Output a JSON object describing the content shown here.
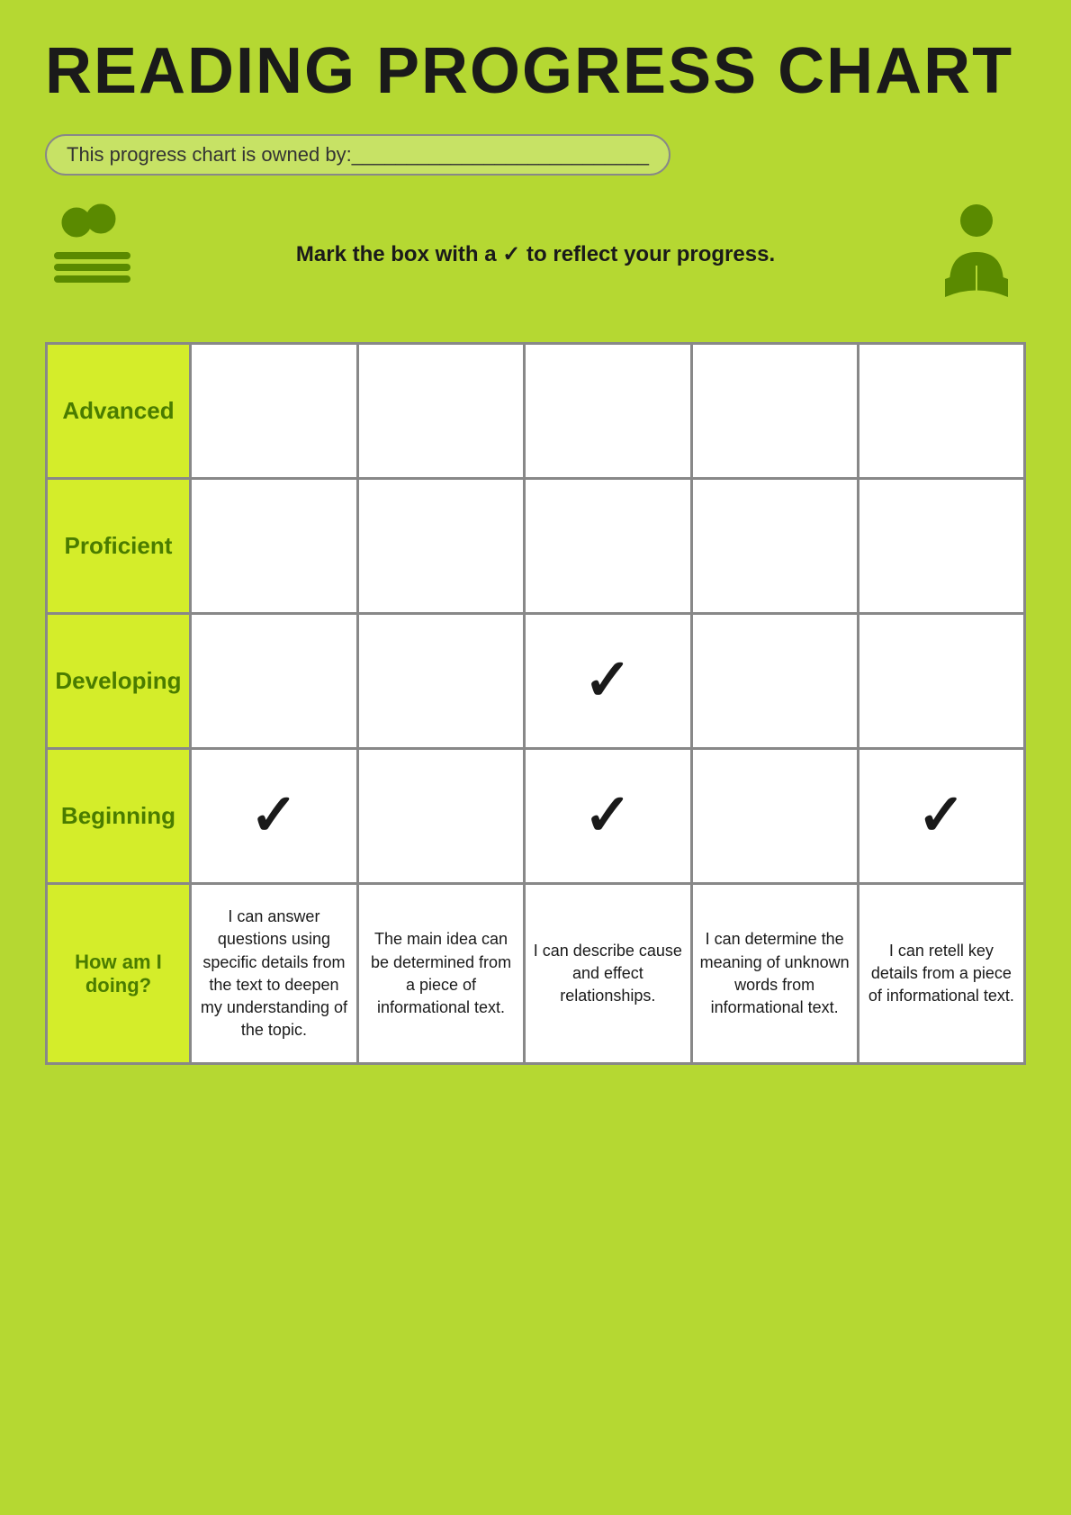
{
  "title": "READING PROGRESS CHART",
  "owner_label": "This progress chart is owned by:___________________________",
  "instructions": "Mark the box with a ✓ to reflect your progress.",
  "rows": [
    {
      "label": "Advanced",
      "checks": [
        false,
        false,
        false,
        false,
        false
      ]
    },
    {
      "label": "Proficient",
      "checks": [
        false,
        false,
        false,
        false,
        false
      ]
    },
    {
      "label": "Developing",
      "checks": [
        false,
        false,
        true,
        false,
        false
      ]
    },
    {
      "label": "Beginning",
      "checks": [
        true,
        false,
        true,
        false,
        true
      ]
    }
  ],
  "how_doing": {
    "label1": "How am I",
    "label2": "doing?",
    "descriptions": [
      "I can answer questions using specific details from the text to deepen my understanding of the topic.",
      "The main idea can be determined from a piece of informational text.",
      "I can describe cause and effect relationships.",
      "I can determine the meaning of unknown words from informational text.",
      "I can retell key details from a piece of informational text."
    ]
  },
  "icons": {
    "teacher": "teacher-icon",
    "reader": "reader-icon"
  }
}
